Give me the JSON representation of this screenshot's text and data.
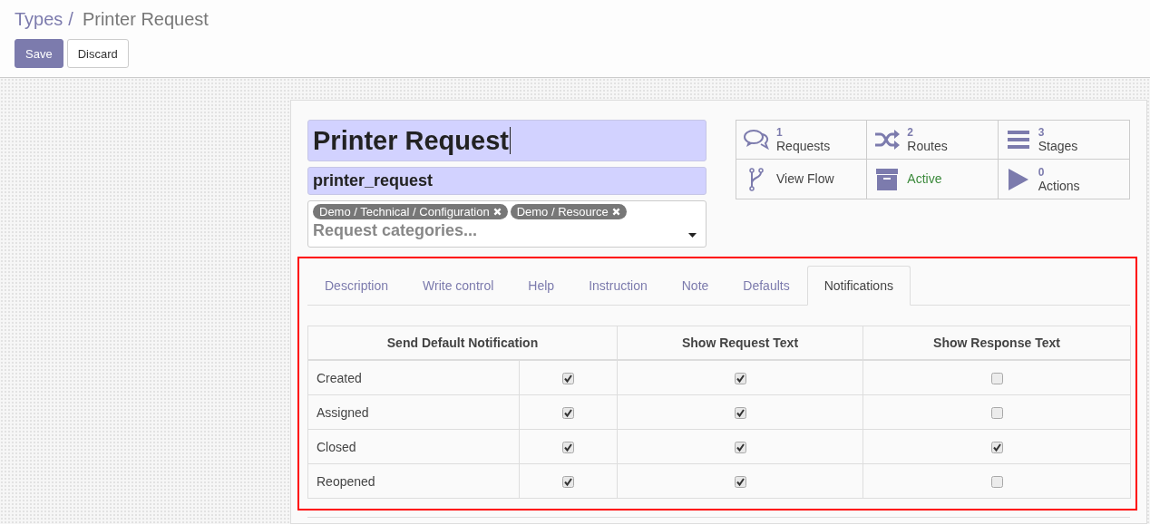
{
  "breadcrumb": {
    "parent": "Types",
    "separator": "/",
    "current": "Printer Request"
  },
  "buttons": [
    {
      "label": "Save",
      "kind": "primary"
    },
    {
      "label": "Discard",
      "kind": "secondary"
    }
  ],
  "form": {
    "name": "Printer Request",
    "code": "printer_request",
    "categories": {
      "tags": [
        "Demo / Technical / Configuration",
        "Demo / Resource"
      ],
      "placeholder": "Request categories..."
    }
  },
  "smart_buttons": [
    {
      "kind": "counter",
      "count": "1",
      "label": "Requests"
    },
    {
      "kind": "counter",
      "count": "2",
      "label": "Routes"
    },
    {
      "kind": "counter",
      "count": "3",
      "label": "Stages"
    },
    {
      "kind": "link",
      "label": "View Flow"
    },
    {
      "kind": "toggle",
      "label": "Active"
    },
    {
      "kind": "counter",
      "count": "0",
      "label": "Actions"
    }
  ],
  "tabs": [
    {
      "label": "Description",
      "selected": false
    },
    {
      "label": "Write control",
      "selected": false
    },
    {
      "label": "Help",
      "selected": false
    },
    {
      "label": "Instruction",
      "selected": false
    },
    {
      "label": "Note",
      "selected": false
    },
    {
      "label": "Defaults",
      "selected": false
    },
    {
      "label": "Notifications",
      "selected": true
    }
  ],
  "table": {
    "columns": [
      "Send Default Notification",
      "Show Request Text",
      "Show Response Text"
    ],
    "rows": [
      {
        "label": "Created",
        "send": true,
        "request": true,
        "response": false
      },
      {
        "label": "Assigned",
        "send": true,
        "request": true,
        "response": false
      },
      {
        "label": "Closed",
        "send": true,
        "request": true,
        "response": true
      },
      {
        "label": "Reopened",
        "send": true,
        "request": true,
        "response": false
      }
    ]
  }
}
